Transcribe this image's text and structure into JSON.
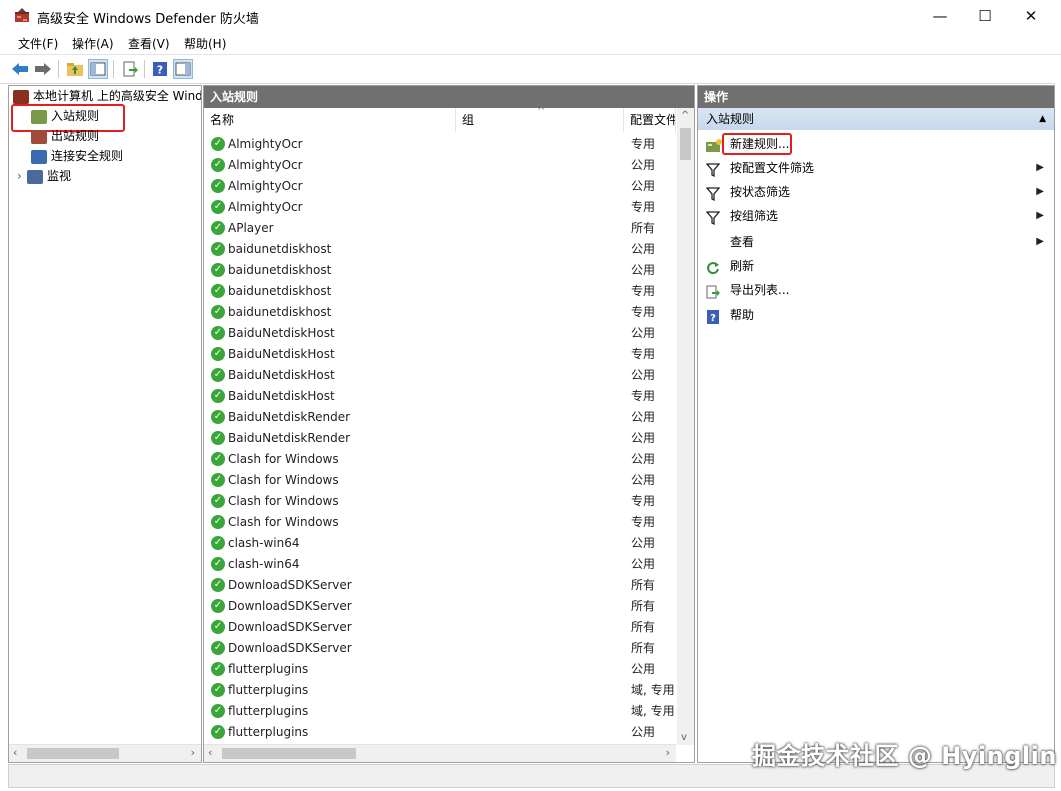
{
  "window": {
    "title": "高级安全 Windows Defender 防火墙",
    "minimize": "—",
    "maximize": "☐",
    "close": "✕"
  },
  "menu": [
    "文件(F)",
    "操作(A)",
    "查看(V)",
    "帮助(H)"
  ],
  "tree": {
    "root": "本地计算机 上的高级安全 Windows Defender 防火墙",
    "items": [
      "入站规则",
      "出站规则",
      "连接安全规则",
      "监视"
    ]
  },
  "middle": {
    "header": "入站规则",
    "columns": [
      "名称",
      "组",
      "配置文件"
    ],
    "rows": [
      {
        "name": "AlmightyOcr",
        "profile": "专用"
      },
      {
        "name": "AlmightyOcr",
        "profile": "公用"
      },
      {
        "name": "AlmightyOcr",
        "profile": "公用"
      },
      {
        "name": "AlmightyOcr",
        "profile": "专用"
      },
      {
        "name": "APlayer",
        "profile": "所有"
      },
      {
        "name": "baidunetdiskhost",
        "profile": "公用"
      },
      {
        "name": "baidunetdiskhost",
        "profile": "公用"
      },
      {
        "name": "baidunetdiskhost",
        "profile": "专用"
      },
      {
        "name": "baidunetdiskhost",
        "profile": "专用"
      },
      {
        "name": "BaiduNetdiskHost",
        "profile": "公用"
      },
      {
        "name": "BaiduNetdiskHost",
        "profile": "专用"
      },
      {
        "name": "BaiduNetdiskHost",
        "profile": "公用"
      },
      {
        "name": "BaiduNetdiskHost",
        "profile": "专用"
      },
      {
        "name": "BaiduNetdiskRender",
        "profile": "公用"
      },
      {
        "name": "BaiduNetdiskRender",
        "profile": "公用"
      },
      {
        "name": "Clash for Windows",
        "profile": "公用"
      },
      {
        "name": "Clash for Windows",
        "profile": "公用"
      },
      {
        "name": "Clash for Windows",
        "profile": "专用"
      },
      {
        "name": "Clash for Windows",
        "profile": "专用"
      },
      {
        "name": "clash-win64",
        "profile": "公用"
      },
      {
        "name": "clash-win64",
        "profile": "公用"
      },
      {
        "name": "DownloadSDKServer",
        "profile": "所有"
      },
      {
        "name": "DownloadSDKServer",
        "profile": "所有"
      },
      {
        "name": "DownloadSDKServer",
        "profile": "所有"
      },
      {
        "name": "DownloadSDKServer",
        "profile": "所有"
      },
      {
        "name": "flutterplugins",
        "profile": "公用"
      },
      {
        "name": "flutterplugins",
        "profile": "域, 专用"
      },
      {
        "name": "flutterplugins",
        "profile": "域, 专用"
      },
      {
        "name": "flutterplugins",
        "profile": "公用"
      }
    ]
  },
  "actions": {
    "header": "操作",
    "section": "入站规则",
    "items": [
      {
        "label": "新建规则...",
        "icon": "new-rule-icon",
        "submenu": false
      },
      {
        "label": "按配置文件筛选",
        "icon": "filter-icon",
        "submenu": true
      },
      {
        "label": "按状态筛选",
        "icon": "filter-icon",
        "submenu": true
      },
      {
        "label": "按组筛选",
        "icon": "filter-icon",
        "submenu": true
      },
      {
        "label": "查看",
        "icon": "",
        "submenu": true
      },
      {
        "label": "刷新",
        "icon": "refresh-icon",
        "submenu": false
      },
      {
        "label": "导出列表...",
        "icon": "export-icon",
        "submenu": false
      },
      {
        "label": "帮助",
        "icon": "help-icon",
        "submenu": false
      }
    ]
  },
  "watermark": "掘金技术社区 @ Hyinglin",
  "colors": {
    "pane_header": "#707070",
    "section_header": "#c7d7ec",
    "highlight": "#e0201c",
    "enabled": "#3aa63a"
  }
}
